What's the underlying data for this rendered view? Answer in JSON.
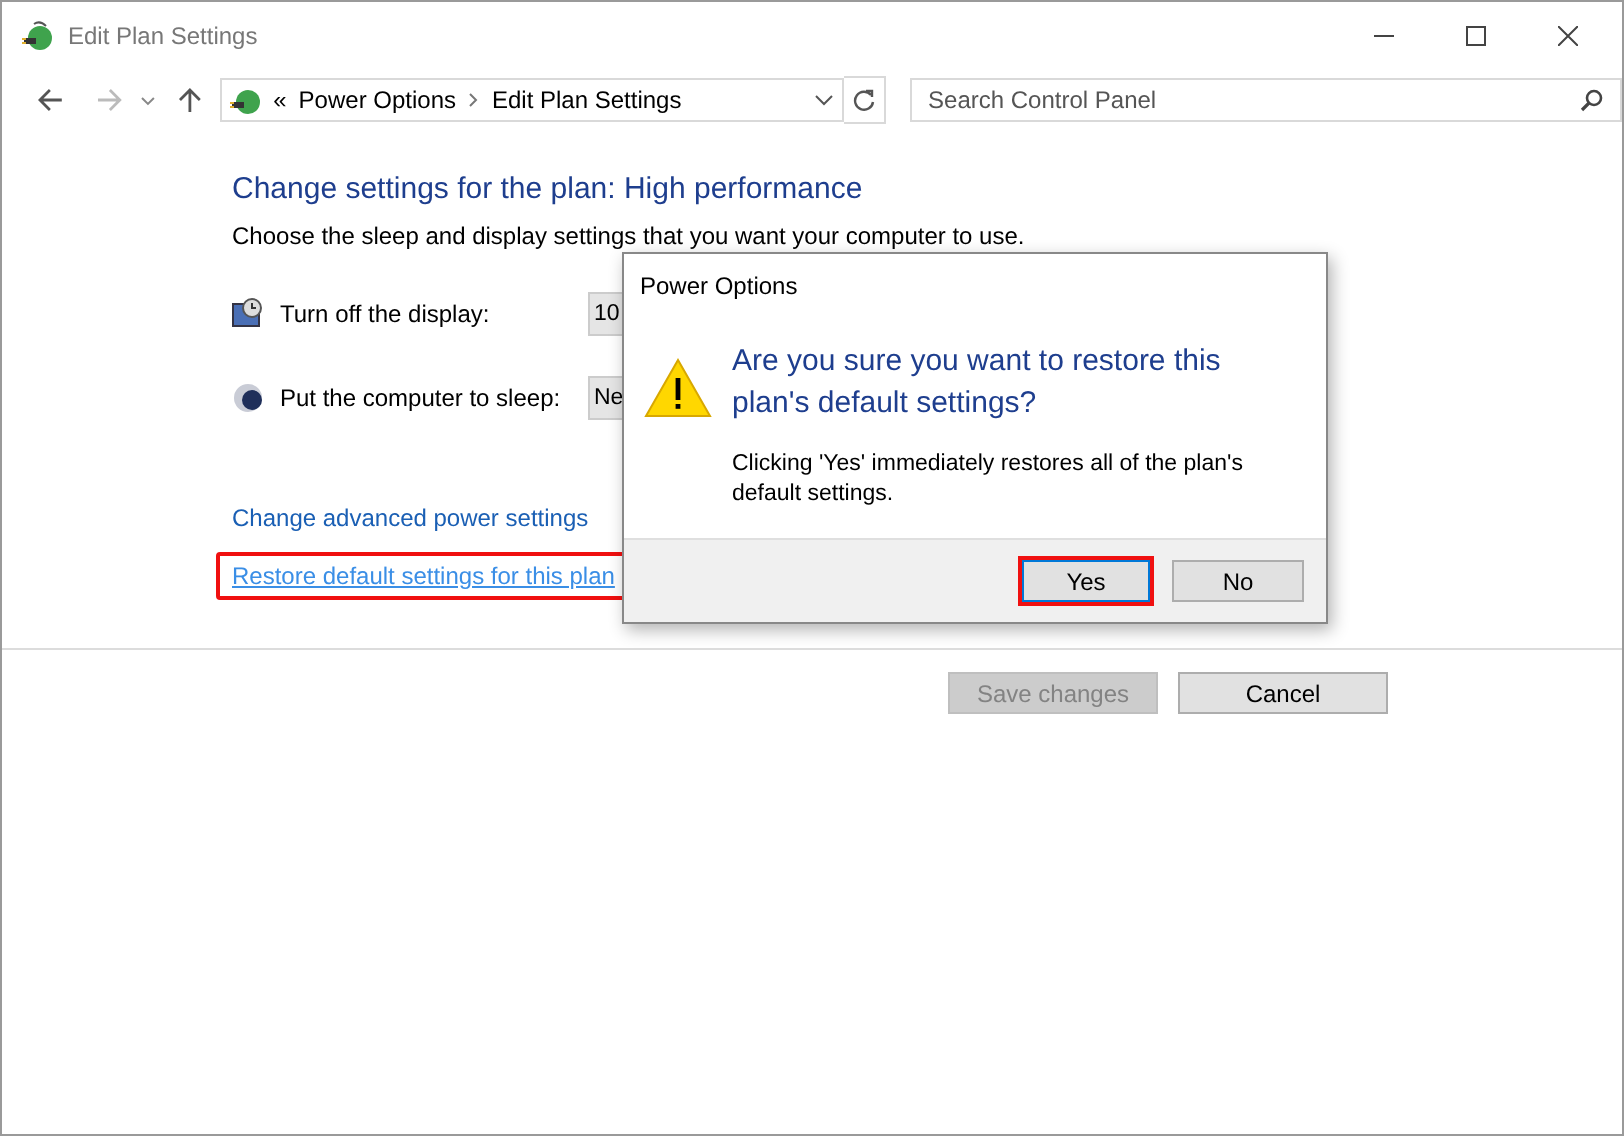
{
  "window": {
    "title": "Edit Plan Settings"
  },
  "address_bar": {
    "prefix": "«",
    "path": [
      {
        "label": "Power Options"
      },
      {
        "label": "Edit Plan Settings"
      }
    ]
  },
  "search": {
    "placeholder": "Search Control Panel"
  },
  "heading": "Change settings for the plan: High performance",
  "description": "Choose the sleep and display settings that you want your computer to use.",
  "settings": [
    {
      "kind": "display",
      "label": "Turn off the display:",
      "value": "10"
    },
    {
      "kind": "sleep",
      "label": "Put the computer to sleep:",
      "value": "Ne"
    }
  ],
  "links": [
    {
      "label": "Change advanced power settings",
      "highlighted": false
    },
    {
      "label": "Restore default settings for this plan",
      "highlighted": true
    }
  ],
  "buttons": [
    {
      "label": "Save changes",
      "disabled": true
    },
    {
      "label": "Cancel",
      "disabled": false
    }
  ],
  "dialog": {
    "title": "Power Options",
    "question": "Are you sure you want to restore this plan's default settings?",
    "message": "Clicking 'Yes' immediately restores all of the plan's default settings.",
    "buttons": [
      {
        "label": "Yes",
        "highlighted": true
      },
      {
        "label": "No",
        "highlighted": false
      }
    ]
  }
}
